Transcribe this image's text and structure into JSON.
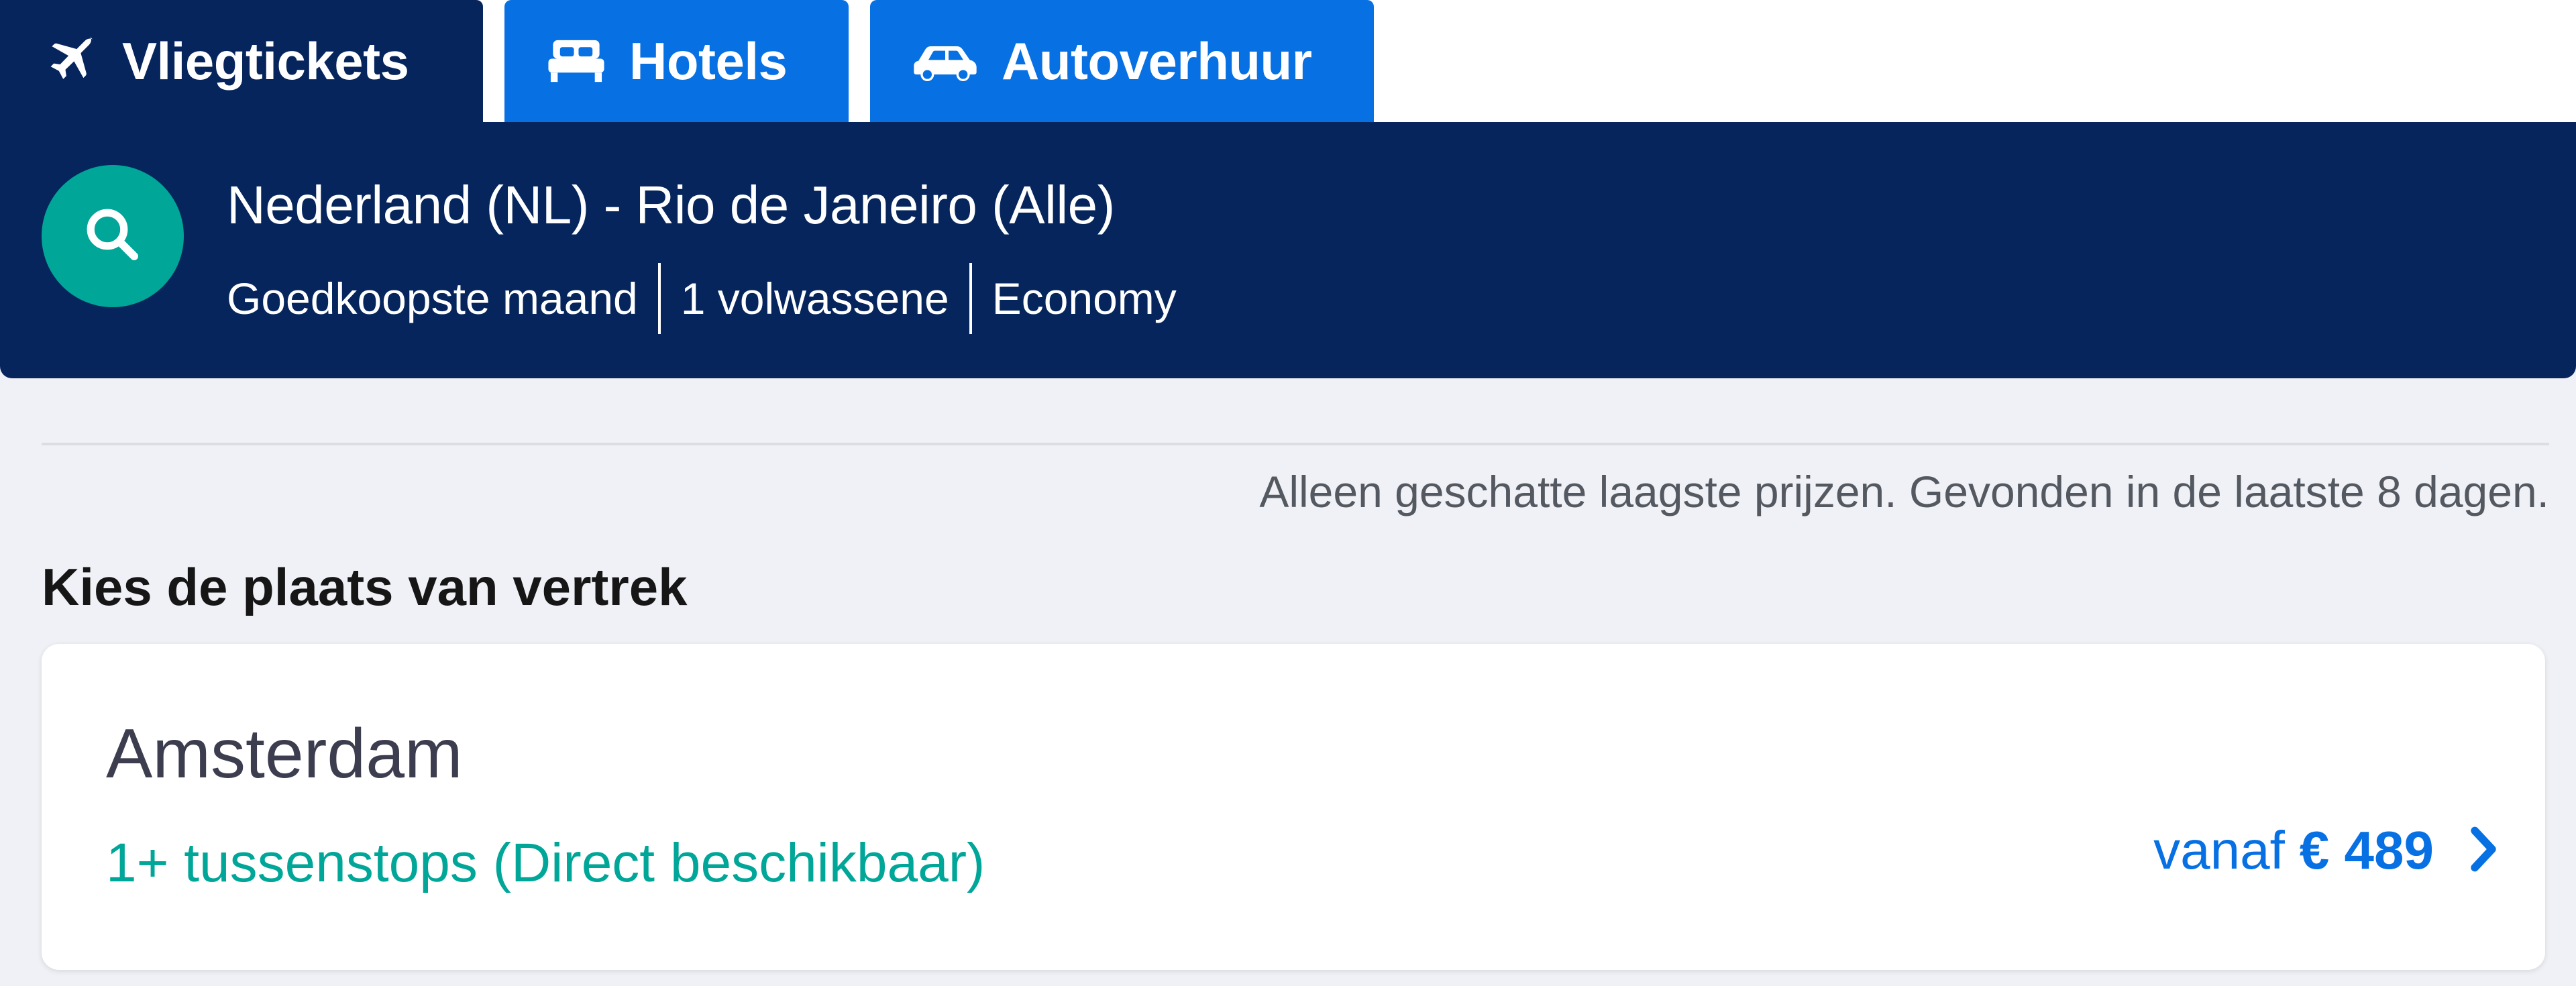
{
  "tabs": [
    {
      "label": "Vliegtickets",
      "icon": "plane-icon",
      "active": true
    },
    {
      "label": "Hotels",
      "icon": "bed-icon",
      "active": false
    },
    {
      "label": "Autoverhuur",
      "icon": "car-icon",
      "active": false
    }
  ],
  "search_summary": {
    "icon": "search-icon",
    "route": "Nederland (NL) - Rio de Janeiro (Alle)",
    "month": "Goedkoopste maand",
    "passengers": "1 volwassene",
    "cabin_class": "Economy"
  },
  "disclaimer": "Alleen geschatte laagste prijzen. Gevonden in de laatste 8 dagen.",
  "section_title": "Kies de plaats van vertrek",
  "results": [
    {
      "city": "Amsterdam",
      "stops": "1+ tussenstops (Direct beschikbaar)",
      "price_prefix": "vanaf",
      "price": "€ 489"
    }
  ],
  "colors": {
    "navy": "#05255c",
    "blue": "#0770e3",
    "teal": "#00a698",
    "background": "#eff1f6"
  }
}
